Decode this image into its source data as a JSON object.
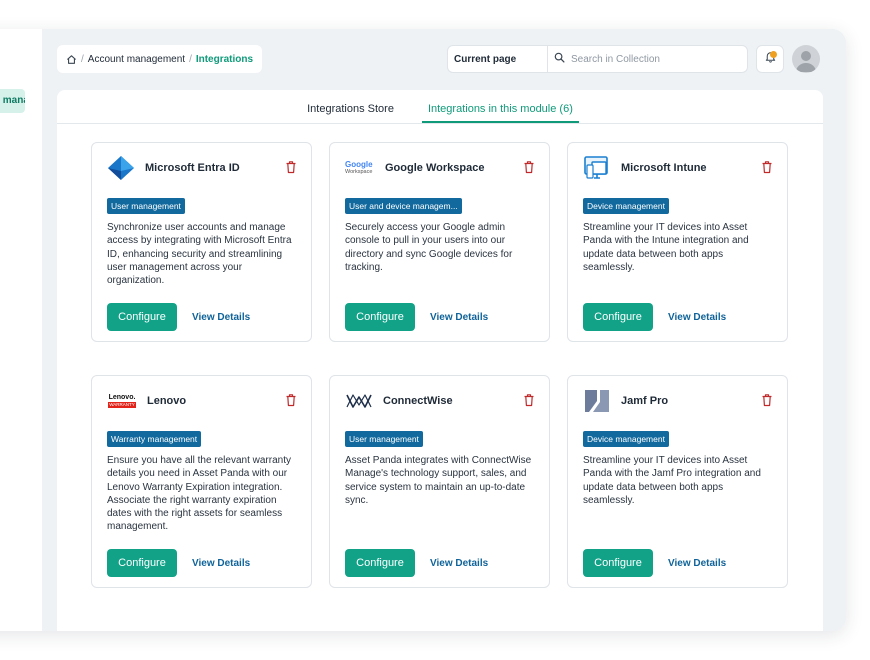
{
  "sidebar": {
    "active_label": "Account management"
  },
  "breadcrumb": {
    "items": [
      "Account management"
    ],
    "current": "Integrations",
    "separator": "/"
  },
  "search": {
    "scope": "Current page",
    "placeholder": "Search in Collection",
    "value": ""
  },
  "tabs": [
    {
      "label": "Integrations Store",
      "active": false
    },
    {
      "label": "Integrations in this module (6)",
      "active": true
    }
  ],
  "colors": {
    "accent": "#11a288",
    "badge": "#11699e",
    "link": "#10639a",
    "notification_dot": "#f0a020",
    "delete": "#c0282a"
  },
  "cards": [
    {
      "title": "Microsoft Entra ID",
      "icon": "entra-id-logo",
      "badge": "User management",
      "description": "Synchronize user accounts and manage access by integrating with  Microsoft Entra ID, enhancing security and streamlining user management  across your organization.",
      "configure": "Configure",
      "details": "View Details"
    },
    {
      "title": "Google Workspace",
      "icon": "google-workspace-logo",
      "logo_text": [
        "Google",
        "Workspace"
      ],
      "badge": "User and device managem...",
      "description": "Securely access your Google admin console to pull in your users into our directory and sync Google devices for tracking.",
      "configure": "Configure",
      "details": "View Details"
    },
    {
      "title": "Microsoft Intune",
      "icon": "intune-logo",
      "badge": "Device management",
      "description": "Streamline your IT devices into Asset Panda with the Intune integration and update data between both apps seamlessly.",
      "configure": "Configure",
      "details": "View Details"
    },
    {
      "title": "Lenovo",
      "icon": "lenovo-logo",
      "logo_text": [
        "Lenovo.",
        "WARRANTY"
      ],
      "badge": "Warranty management",
      "description": "Ensure you have  all the relevant warranty details you need in Asset Panda with our Lenovo Warranty Expiration integration. Associate the right warranty  expiration dates with the right assets for seamless management.",
      "configure": "Configure",
      "details": "View Details"
    },
    {
      "title": "ConnectWise",
      "icon": "connectwise-logo",
      "badge": "User management",
      "description": "Asset Panda integrates with ConnectWise Manage's technology support, sales, and service system to maintain an up-to-date sync.",
      "configure": "Configure",
      "details": "View Details"
    },
    {
      "title": "Jamf Pro",
      "icon": "jamf-logo",
      "badge": "Device management",
      "description": "Streamline your IT devices into Asset Panda with the Jamf Pro integration and update data between both apps seamlessly.",
      "configure": "Configure",
      "details": "View Details"
    }
  ]
}
